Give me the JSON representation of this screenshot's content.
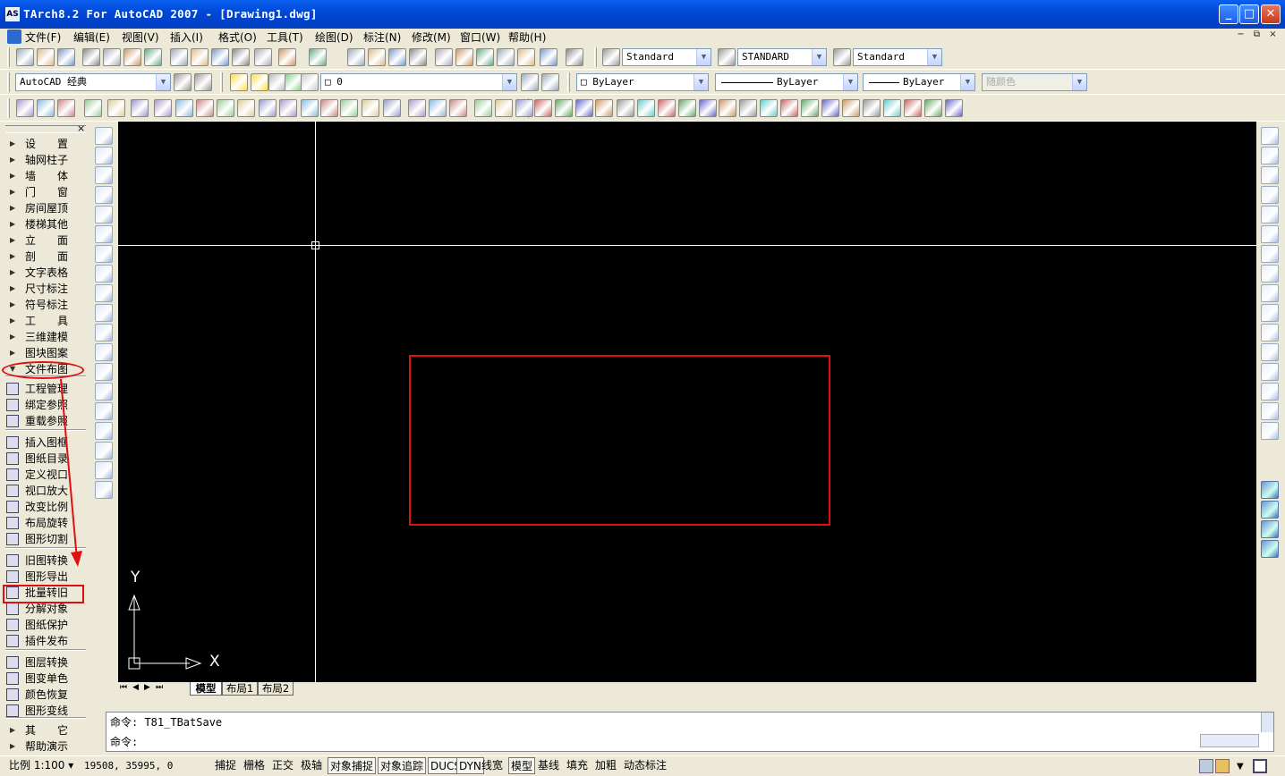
{
  "window": {
    "title": "TArch8.2 For AutoCAD 2007 - [Drawing1.dwg]",
    "app_icon_glyph": "AS",
    "minimize_glyph": "_",
    "maximize_glyph": "□",
    "close_glyph": "✕"
  },
  "menu": [
    "文件(F)",
    "编辑(E)",
    "视图(V)",
    "插入(I)",
    "格式(O)",
    "工具(T)",
    "绘图(D)",
    "标注(N)",
    "修改(M)",
    "窗口(W)",
    "帮助(H)"
  ],
  "mdi_controls": [
    "−",
    "⧉",
    "×"
  ],
  "toolbar": {
    "text_style": "Standard",
    "dim_style": "STANDARD",
    "table_style": "Standard",
    "workspace": "AutoCAD 经典",
    "layer": "□ 0",
    "color": "□ ByLayer",
    "linetype": "ByLayer",
    "lineweight": "ByLayer",
    "plotstyle": "随颜色"
  },
  "tarch_panel": {
    "items": [
      {
        "label": "设　　置",
        "type": "cat"
      },
      {
        "label": "轴网柱子",
        "type": "cat"
      },
      {
        "label": "墙　　体",
        "type": "cat"
      },
      {
        "label": "门　　窗",
        "type": "cat"
      },
      {
        "label": "房间屋顶",
        "type": "cat"
      },
      {
        "label": "楼梯其他",
        "type": "cat"
      },
      {
        "label": "立　　面",
        "type": "cat"
      },
      {
        "label": "剖　　面",
        "type": "cat"
      },
      {
        "label": "文字表格",
        "type": "cat"
      },
      {
        "label": "尺寸标注",
        "type": "cat"
      },
      {
        "label": "符号标注",
        "type": "cat"
      },
      {
        "label": "工　　具",
        "type": "cat"
      },
      {
        "label": "三维建模",
        "type": "cat"
      },
      {
        "label": "图块图案",
        "type": "cat"
      },
      {
        "label": "文件布图",
        "type": "open"
      },
      {
        "label": "工程管理",
        "type": "cmd"
      },
      {
        "label": "绑定参照",
        "type": "cmd"
      },
      {
        "label": "重载参照",
        "type": "cmd"
      },
      {
        "label": "插入图框",
        "type": "cmd"
      },
      {
        "label": "图纸目录",
        "type": "cmd"
      },
      {
        "label": "定义视口",
        "type": "cmd"
      },
      {
        "label": "视口放大",
        "type": "cmd"
      },
      {
        "label": "改变比例",
        "type": "cmd"
      },
      {
        "label": "布局旋转",
        "type": "cmd"
      },
      {
        "label": "图形切割",
        "type": "cmd"
      },
      {
        "label": "旧图转换",
        "type": "cmd"
      },
      {
        "label": "图形导出",
        "type": "cmd"
      },
      {
        "label": "批量转旧",
        "type": "cmd"
      },
      {
        "label": "分解对象",
        "type": "cmd"
      },
      {
        "label": "图纸保护",
        "type": "cmd"
      },
      {
        "label": "插件发布",
        "type": "cmd"
      },
      {
        "label": "图层转换",
        "type": "cmd"
      },
      {
        "label": "图变单色",
        "type": "cmd"
      },
      {
        "label": "颜色恢复",
        "type": "cmd"
      },
      {
        "label": "图形变线",
        "type": "cmd"
      },
      {
        "label": "其　　它",
        "type": "cat"
      },
      {
        "label": "帮助演示",
        "type": "cat"
      }
    ]
  },
  "canvas": {
    "ucs_x": "X",
    "ucs_y": "Y"
  },
  "layout_tabs": [
    "模型",
    "布局1",
    "布局2"
  ],
  "command": {
    "history": "命令: T81_TBatSave",
    "prompt": "命令:"
  },
  "status": {
    "scale": "比例 1:100",
    "coords": "19508,  35995, 0",
    "toggles": [
      {
        "label": "捕捉",
        "on": false
      },
      {
        "label": "栅格",
        "on": false
      },
      {
        "label": "正交",
        "on": false
      },
      {
        "label": "极轴",
        "on": false
      },
      {
        "label": "对象捕捉",
        "on": true
      },
      {
        "label": "对象追踪",
        "on": true
      },
      {
        "label": "DUCS",
        "on": true
      },
      {
        "label": "DYN",
        "on": true
      },
      {
        "label": "线宽",
        "on": false
      },
      {
        "label": "模型",
        "on": true
      },
      {
        "label": "基线",
        "on": false
      },
      {
        "label": "填充",
        "on": false
      },
      {
        "label": "加粗",
        "on": false
      },
      {
        "label": "动态标注",
        "on": false
      }
    ]
  },
  "colors": {
    "title_blue": "#0a5ff0",
    "annotation_red": "#e01010",
    "canvas": "#000000",
    "chrome": "#ece9d8"
  }
}
